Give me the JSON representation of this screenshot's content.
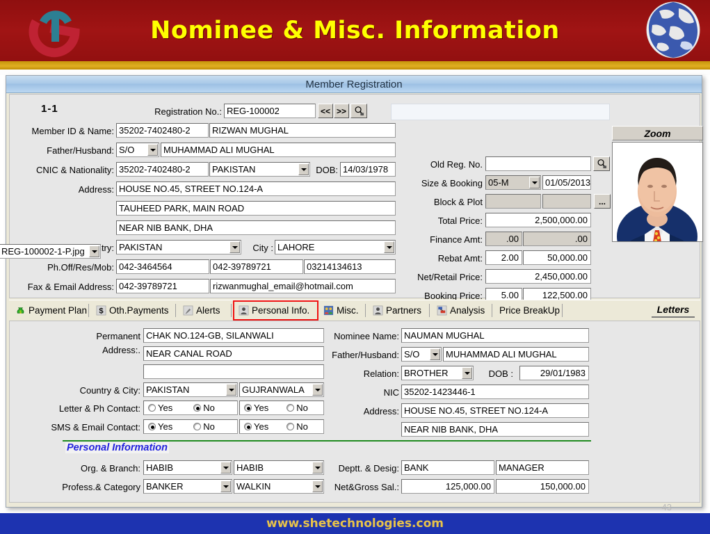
{
  "slide": {
    "title": "Nominee & Misc. Information",
    "page_number": "43",
    "footer_url": "www.shetechnologies.com",
    "logo_icon": "she-logo-icon",
    "globe_icon": "globe-icon",
    "colors": {
      "header_bg": "#9e1111",
      "header_text": "#ffff00",
      "gold_bar": "#d4a017",
      "footer_bg": "#1d33b0",
      "footer_text": "#e8c34a",
      "active_tab_ring": "#ef1111",
      "section_title": "#2222dd",
      "green_rule": "#1f8a1f"
    }
  },
  "window": {
    "title": "Member Registration"
  },
  "top_panel": {
    "record_no": "1-1",
    "registration": {
      "label": "Registration No.:",
      "value": "REG-100002",
      "prev_label": "<<",
      "next_label": ">>",
      "search_icon": "magnifier-icon"
    },
    "member": {
      "label": "Member ID & Name:",
      "id": "35202-7402480-2",
      "name": "RIZWAN MUGHAL"
    },
    "father_husband": {
      "label": "Father/Husband:",
      "relation": "S/O",
      "name": "MUHAMMAD ALI MUGHAL"
    },
    "cnic": {
      "label": "CNIC & Nationality:",
      "value": "35202-7402480-2",
      "nationality": "PAKISTAN",
      "dob_label": "DOB:",
      "dob": "14/03/1978"
    },
    "address": {
      "label": "Address:",
      "line1": "HOUSE NO.45, STREET NO.124-A",
      "line2": "TAUHEED PARK, MAIN ROAD",
      "line3": "NEAR NIB BANK, DHA"
    },
    "country": {
      "label": "Country:",
      "value": "PAKISTAN",
      "city_label": "City :",
      "city": "LAHORE"
    },
    "phones": {
      "label": "Ph.Off/Res/Mob:",
      "office": "042-3464564",
      "residence": "042-39789721",
      "mobile": "03214134613"
    },
    "fax_email": {
      "label": "Fax & Email Address:",
      "fax": "042-39789721",
      "email": "rizwanmughal_email@hotmail.com"
    },
    "old_reg": {
      "label": "Old Reg. No.",
      "value": "",
      "search_icon": "magnifier-icon"
    },
    "size_booking": {
      "label": "Size & Booking",
      "size": "05-M",
      "date": "01/05/2013"
    },
    "block_plot": {
      "label": "Block & Plot",
      "block": "",
      "plot": "",
      "browse_label": "..."
    },
    "total_price": {
      "label": "Total Price:",
      "value": "2,500,000.00"
    },
    "finance_amt": {
      "label": "Finance Amt:",
      "pct": ".00",
      "value": ".00"
    },
    "rebat_amt": {
      "label": "Rebat Amt:",
      "pct": "2.00",
      "value": "50,000.00"
    },
    "net_retail": {
      "label": "Net/Retail Price:",
      "value": "2,450,000.00"
    },
    "booking_price": {
      "label": "Booking Price:",
      "pct": "5.00",
      "value": "122,500.00"
    },
    "zoom_box": {
      "header": "Zoom",
      "photo_alt": "member-photo",
      "file_name": "REG-100002-1-P.jpg"
    }
  },
  "tabs": {
    "items": [
      {
        "label": "Payment Plan",
        "icon": "money-bag-icon",
        "active": false
      },
      {
        "label": "Oth.Payments",
        "icon": "dollar-icon",
        "active": false
      },
      {
        "label": "Alerts",
        "icon": "bell-icon",
        "active": false
      },
      {
        "label": "Personal Info.",
        "icon": "person-icon",
        "active": true
      },
      {
        "label": "Misc.",
        "icon": "people-icon",
        "active": false
      },
      {
        "label": "Partners",
        "icon": "person-icon",
        "active": false
      },
      {
        "label": "Analysis",
        "icon": "chart-icon",
        "active": false
      },
      {
        "label": "Price BreakUp",
        "icon": "none",
        "active": false
      }
    ],
    "letters_button": "Letters"
  },
  "bottom_panel": {
    "permanent_address": {
      "label_line1": "Permanent",
      "label_line2": "Address:.",
      "line1": "CHAK NO.124-GB, SILANWALI",
      "line2": "NEAR CANAL ROAD",
      "line3": ""
    },
    "country_city": {
      "label": "Country & City:",
      "country": "PAKISTAN",
      "city": "GUJRANWALA"
    },
    "letter_ph_contact": {
      "label": "Letter & Ph Contact:",
      "letter": {
        "yes_label": "Yes",
        "no_label": "No",
        "selected": "No"
      },
      "phone": {
        "yes_label": "Yes",
        "no_label": "No",
        "selected": "Yes"
      }
    },
    "sms_email_contact": {
      "label": "SMS & Email Contact:",
      "sms": {
        "yes_label": "Yes",
        "no_label": "No",
        "selected": "Yes"
      },
      "email": {
        "yes_label": "Yes",
        "no_label": "No",
        "selected": "Yes"
      }
    },
    "nominee": {
      "name_label": "Nominee Name:",
      "name": "NAUMAN MUGHAL",
      "father_label": "Father/Husband:",
      "father_relation": "S/O",
      "father_name": "MUHAMMAD ALI MUGHAL",
      "relation_label": "Relation:",
      "relation": "BROTHER",
      "dob_label": "DOB :",
      "dob": "29/01/1983",
      "nic_label": "NIC",
      "nic": "35202-1423446-1",
      "address_label": "Address:",
      "address_line1": "HOUSE NO.45, STREET NO.124-A",
      "address_line2": "NEAR NIB BANK, DHA"
    },
    "personal_information": {
      "section_title": "Personal Information",
      "org_branch": {
        "label": "Org. & Branch:",
        "org": "HABIB",
        "branch": "HABIB"
      },
      "profess_category": {
        "label": "Profess.& Category",
        "profession": "BANKER",
        "category": "WALKIN"
      },
      "deptt_desig": {
        "label": "Deptt. & Desig:",
        "deptt": "BANK",
        "desig": "MANAGER"
      },
      "net_gross_sal": {
        "label": "Net&Gross Sal.:",
        "net": "125,000.00",
        "gross": "150,000.00"
      }
    }
  }
}
